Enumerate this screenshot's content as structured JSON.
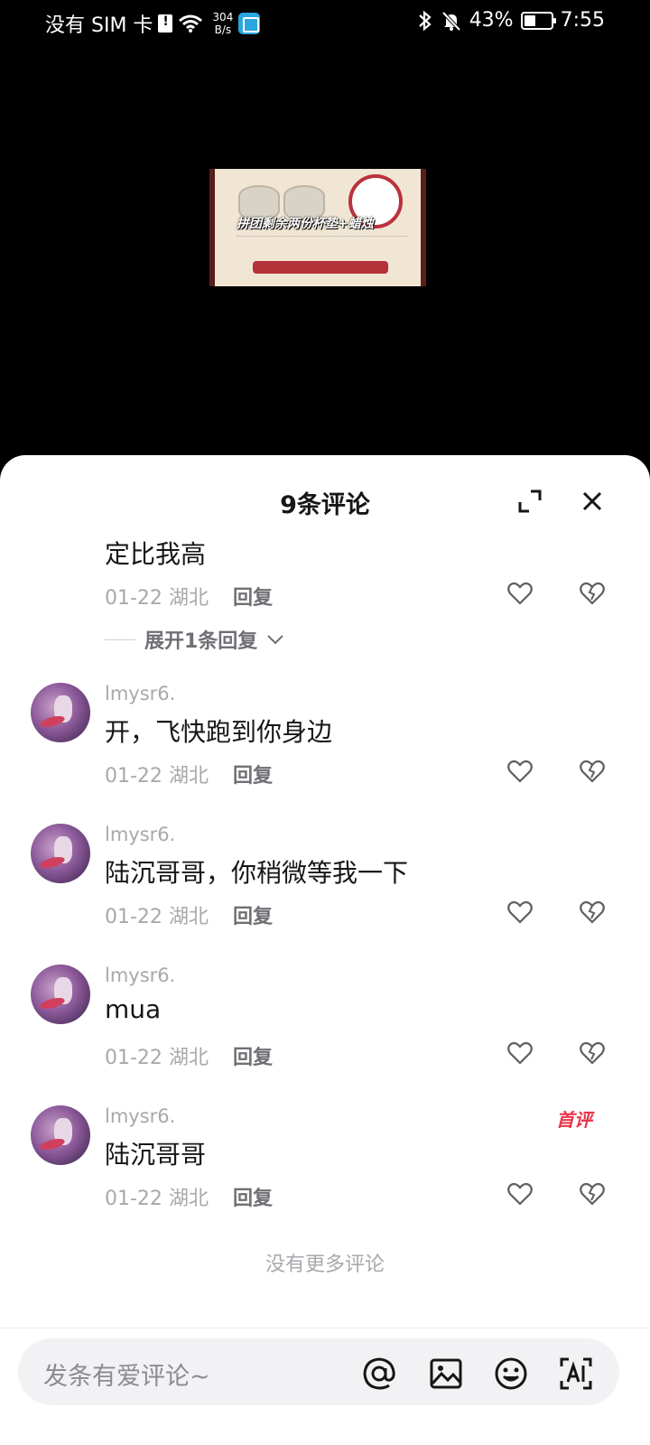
{
  "status_bar": {
    "sim": "没有 SIM 卡",
    "speed_value": "304",
    "speed_unit": "B/s",
    "battery": "43%",
    "battery_level": 0.43,
    "time": "7:55"
  },
  "video": {
    "caption": "拼团剩余两份杯垫+蜡烛"
  },
  "sheet": {
    "title": "9条评论"
  },
  "comments": [
    {
      "text": "定比我高",
      "date": "01-22",
      "location": "湖北",
      "reply": "回复"
    },
    {
      "user": "lmysr6.",
      "text": "开，飞快跑到你身边",
      "date": "01-22",
      "location": "湖北",
      "reply": "回复"
    },
    {
      "user": "lmysr6.",
      "text": "陆沉哥哥，你稍微等我一下",
      "date": "01-22",
      "location": "湖北",
      "reply": "回复"
    },
    {
      "user": "lmysr6.",
      "text": "mua",
      "date": "01-22",
      "location": "湖北",
      "reply": "回复"
    },
    {
      "user": "lmysr6.",
      "text": "陆沉哥哥",
      "date": "01-22",
      "location": "湖北",
      "reply": "回复",
      "badge": "首评"
    }
  ],
  "expand_replies": "展开1条回复",
  "no_more": "没有更多评论",
  "input": {
    "placeholder": "发条有爱评论~"
  },
  "colors": {
    "accent": "#e8354a",
    "muted": "#a8a8ad",
    "text": "#161616"
  }
}
